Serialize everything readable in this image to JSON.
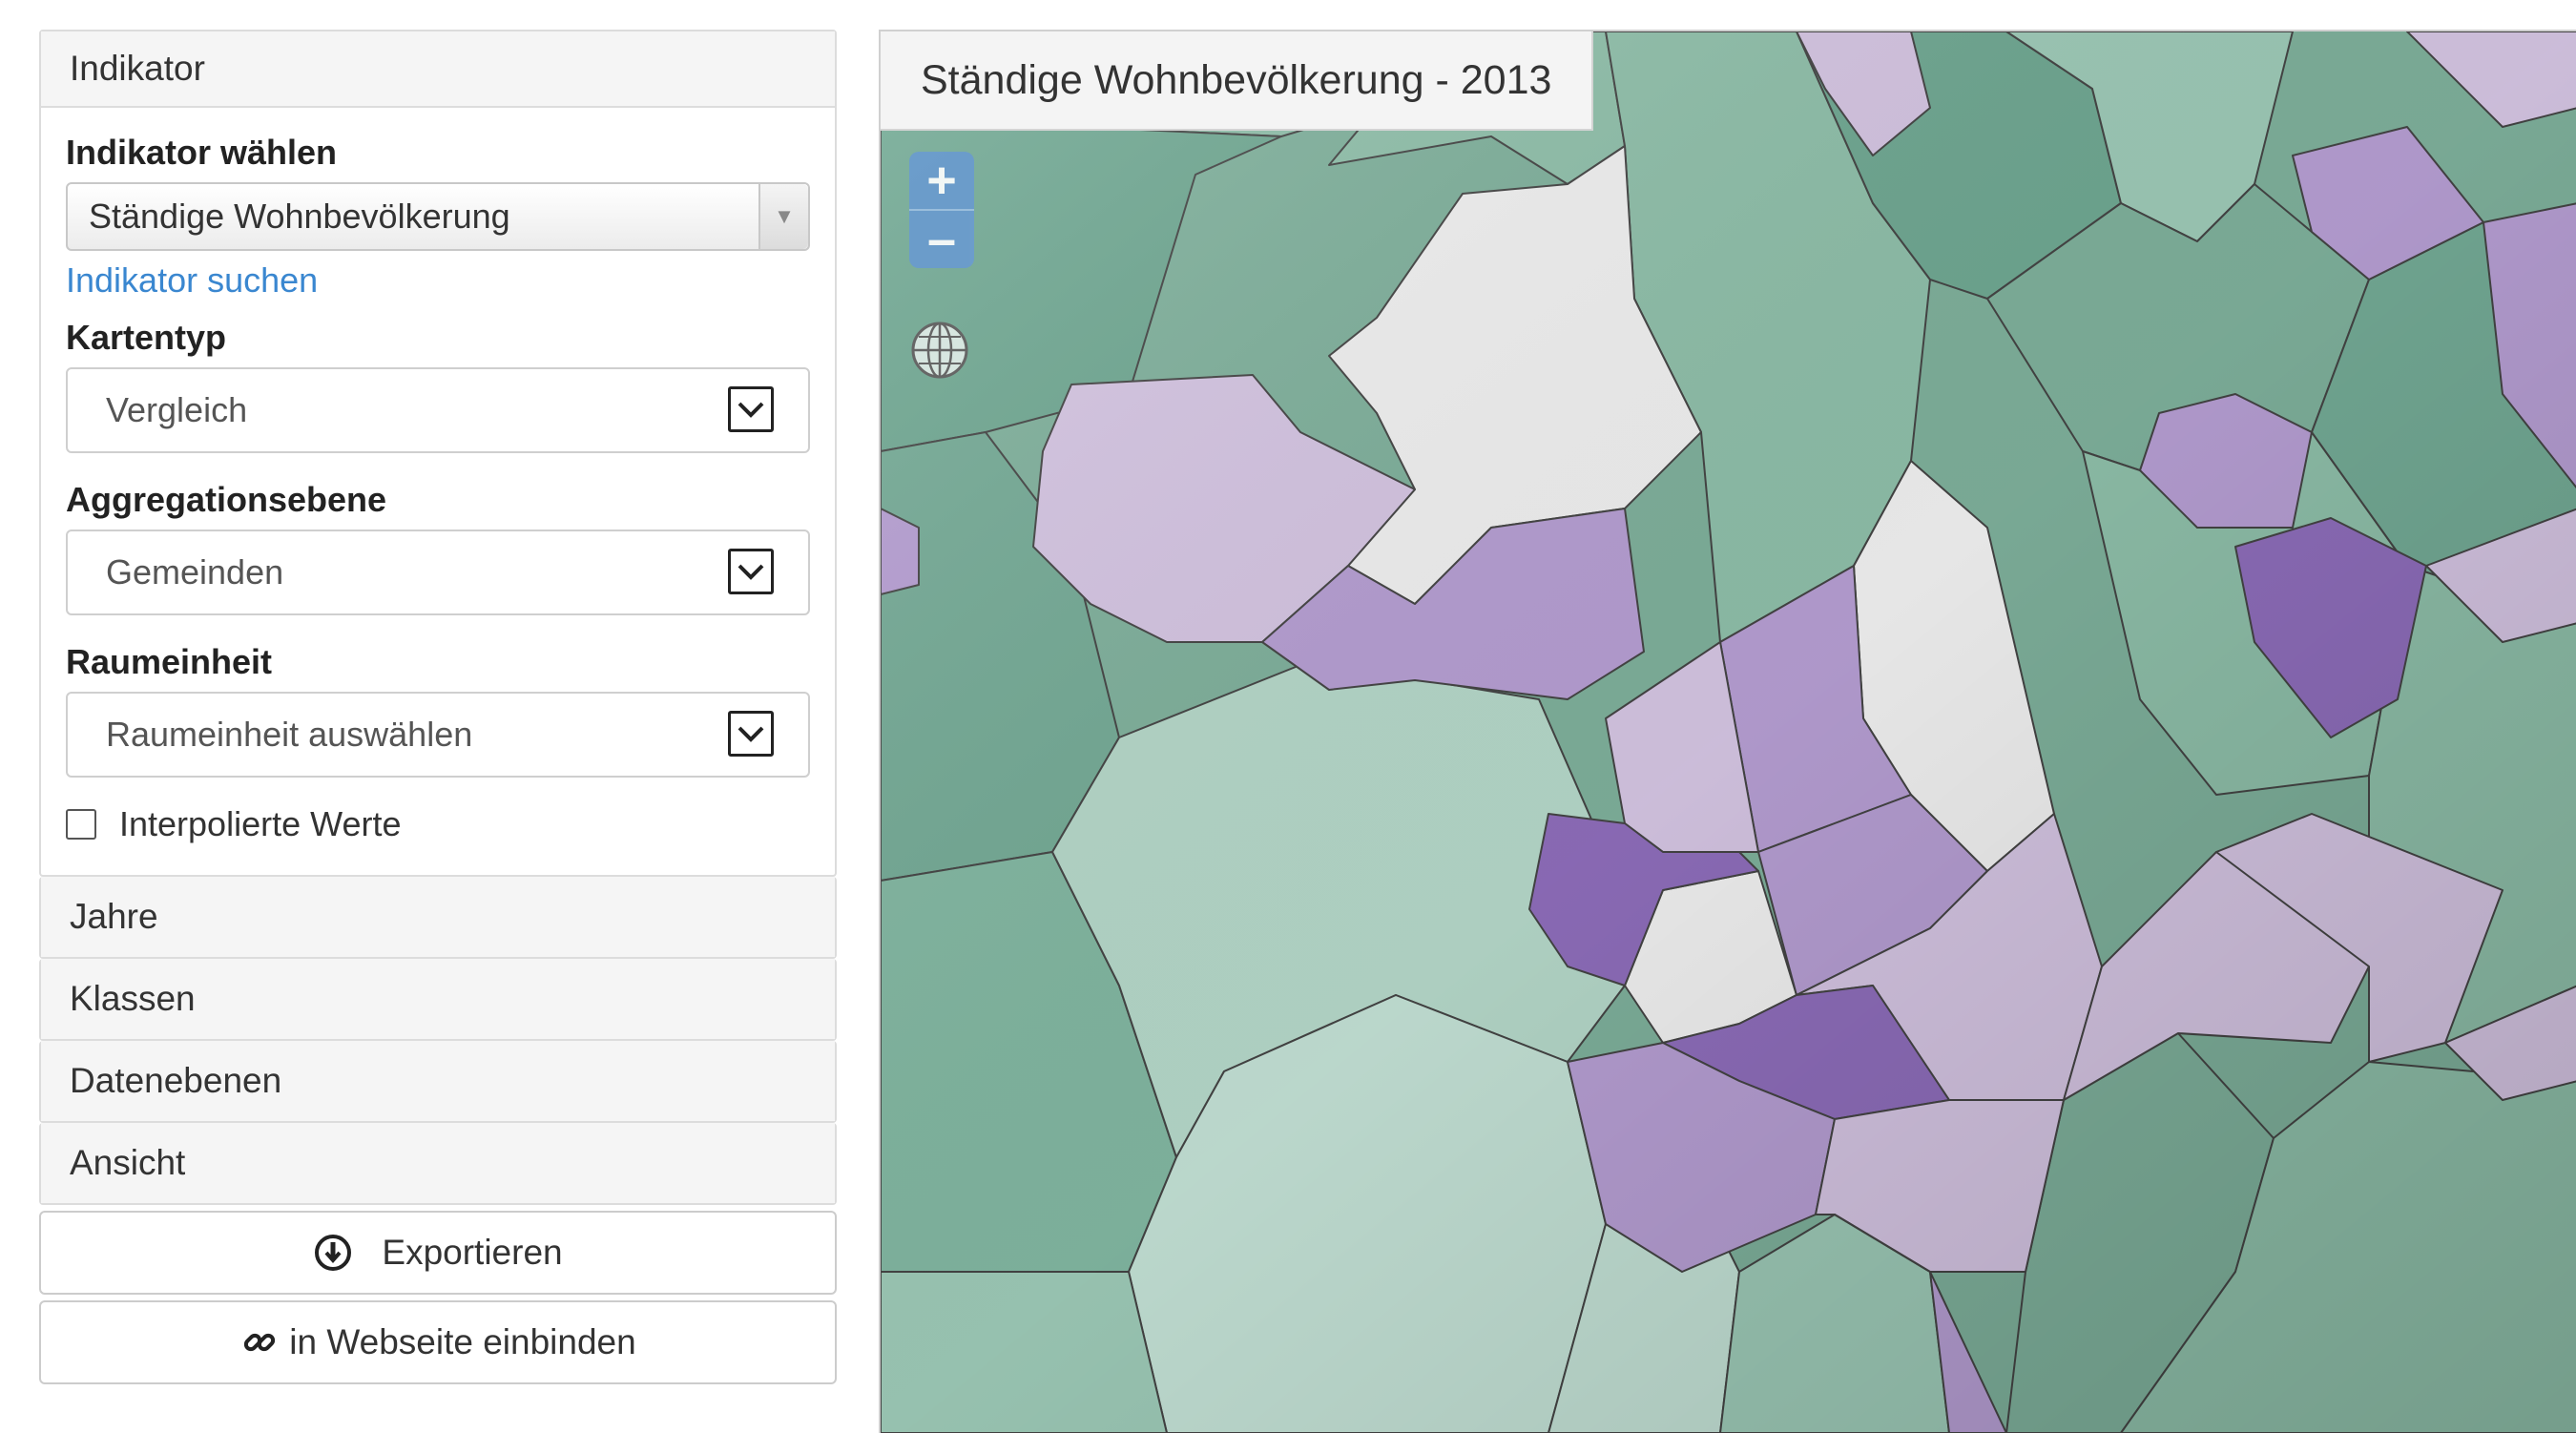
{
  "sidebar": {
    "indicator_panel": {
      "heading": "Indikator",
      "indicator_label": "Indikator wählen",
      "indicator_value": "Ständige Wohnbevölkerung",
      "search_link": "Indikator suchen",
      "map_type_label": "Kartentyp",
      "map_type_value": "Vergleich",
      "aggregation_label": "Aggregationsebene",
      "aggregation_value": "Gemeinden",
      "spatial_unit_label": "Raumeinheit",
      "spatial_unit_value": "Raumeinheit auswählen",
      "interpolated_label": "Interpolierte Werte",
      "interpolated_checked": false
    },
    "collapsed_panels": [
      "Jahre",
      "Klassen",
      "Datenebenen",
      "Ansicht"
    ],
    "export_button": "Exportieren",
    "embed_button": "in Webseite einbinden"
  },
  "map": {
    "title": "Ständige Wohnbevölkerung - 2013",
    "zoom_in": "+",
    "zoom_out": "–",
    "icons": [
      "zoom-in-icon",
      "zoom-out-icon",
      "globe-icon",
      "export-icon",
      "link-icon"
    ],
    "colors": {
      "green_dark": "#6fa892",
      "green_mid": "#8fc0aa",
      "green_light": "#c4e2d6",
      "white": "#f2f2f2",
      "purple_light": "#d6c6e4",
      "purple_mid": "#b79fd4",
      "purple_dark": "#8f6ebc",
      "border": "#444444",
      "accent_link": "#3a87d0",
      "zoom_button": "#6a9bd0"
    }
  }
}
